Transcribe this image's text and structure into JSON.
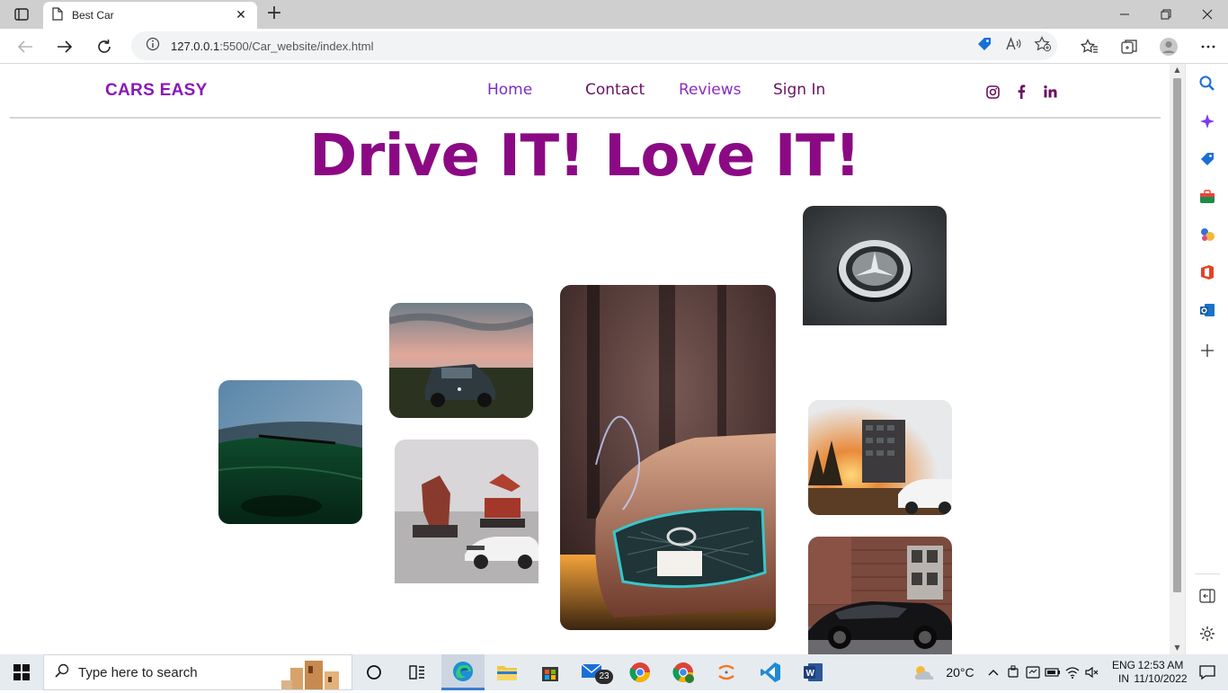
{
  "browser": {
    "tab_title": "Best Car",
    "tab_close": "✕",
    "new_tab": "+",
    "url_host": "127.0.0.1",
    "url_path": ":5500/Car_website/index.html"
  },
  "site": {
    "brand": "CARS EASY",
    "nav": [
      {
        "label": "Home",
        "color": "#7b2fc0"
      },
      {
        "label": "Contact",
        "color": "#6a1263"
      },
      {
        "label": "Reviews",
        "color": "#8a2cc0"
      },
      {
        "label": "Sign In",
        "color": "#6a1263"
      }
    ],
    "social_icons": [
      "instagram-icon",
      "facebook-icon",
      "linkedin-icon"
    ],
    "hero_title": "Drive IT! Love IT!",
    "accent": "#8b0a84"
  },
  "gallery": [
    {
      "name": "green-car-hood-photo"
    },
    {
      "name": "jeep-sunset-photo"
    },
    {
      "name": "excavators-honda-photo"
    },
    {
      "name": "hyundai-front-photo"
    },
    {
      "name": "mercedes-emblem-photo"
    },
    {
      "name": "audi-building-photo"
    },
    {
      "name": "black-car-brick-photo"
    }
  ],
  "taskbar": {
    "search_placeholder": "Type here to search",
    "mail_badge": "23",
    "weather": "20°C",
    "lang_top": "ENG",
    "lang_bottom": "IN",
    "time": "12:53 AM",
    "date": "11/10/2022"
  }
}
